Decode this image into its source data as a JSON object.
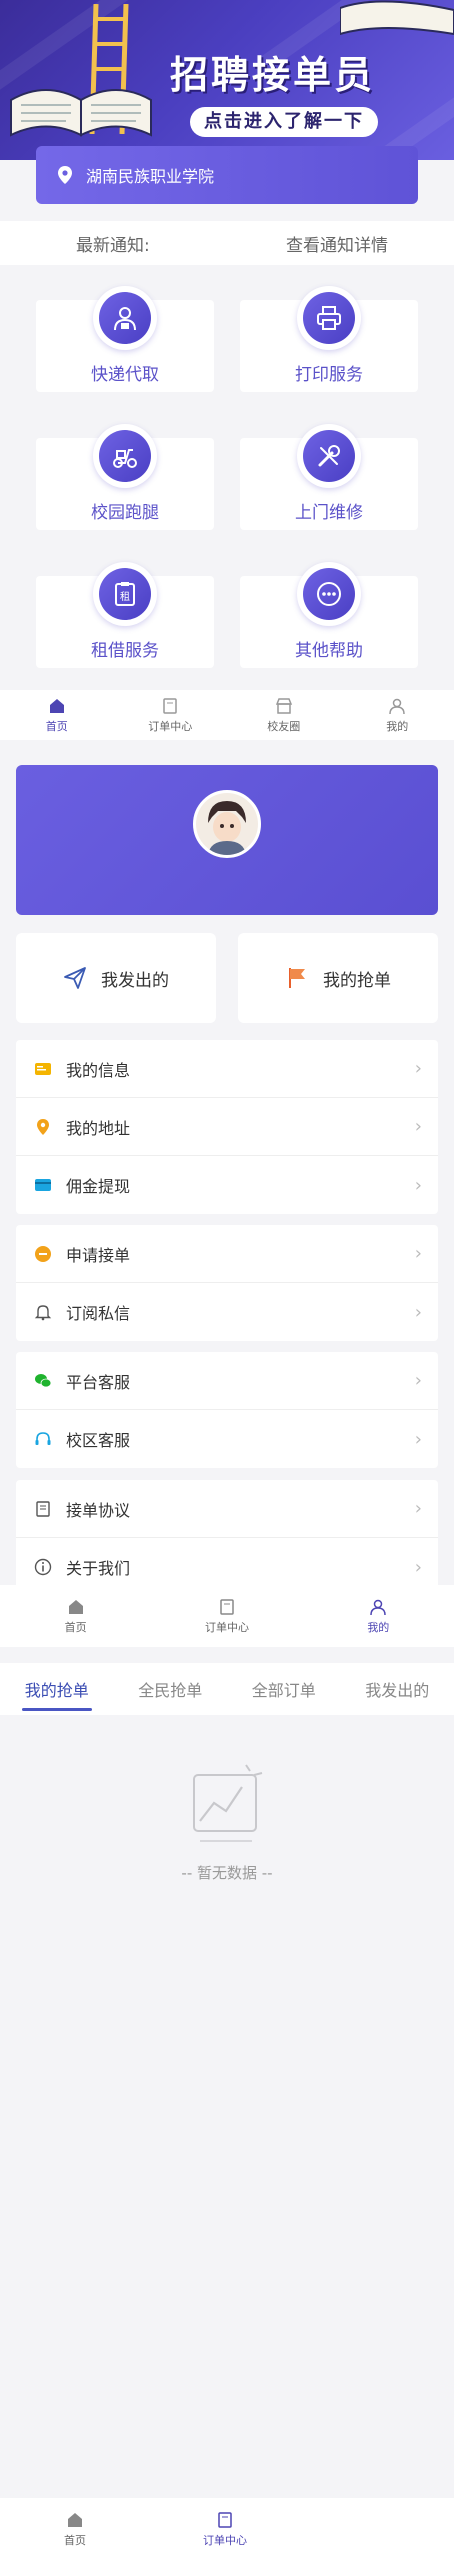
{
  "home": {
    "banner": {
      "title": "招聘接单员",
      "subtitle": "点击进入了解一下"
    },
    "school": "湖南民族职业学院",
    "notice": {
      "label": "最新通知:",
      "link": "查看通知详情"
    },
    "services": [
      {
        "label": "快递代取",
        "icon": "courier-icon"
      },
      {
        "label": "打印服务",
        "icon": "printer-icon"
      },
      {
        "label": "校园跑腿",
        "icon": "scooter-icon"
      },
      {
        "label": "上门维修",
        "icon": "wrench-icon"
      },
      {
        "label": "租借服务",
        "icon": "rent-icon"
      },
      {
        "label": "其他帮助",
        "icon": "more-icon"
      }
    ],
    "tabbar": [
      {
        "label": "首页",
        "icon": "home-icon"
      },
      {
        "label": "订单中心",
        "icon": "orders-icon"
      },
      {
        "label": "校友圈",
        "icon": "store-icon"
      },
      {
        "label": "我的",
        "icon": "user-icon"
      }
    ]
  },
  "mine": {
    "buttons": {
      "sent": "我发出的",
      "grabbed": "我的抢单"
    },
    "menu1": [
      "我的信息",
      "我的地址",
      "佣金提现"
    ],
    "menu2": [
      "申请接单",
      "订阅私信"
    ],
    "menu3": [
      "平台客服",
      "校区客服"
    ],
    "menu4": [
      "接单协议",
      "关于我们"
    ],
    "tabbar": [
      {
        "label": "首页",
        "icon": "home-icon"
      },
      {
        "label": "订单中心",
        "icon": "orders-icon"
      },
      {
        "label": "我的",
        "icon": "user-icon"
      }
    ]
  },
  "orders": {
    "tabs": [
      "我的抢单",
      "全民抢单",
      "全部订单",
      "我发出的"
    ],
    "empty": "-- 暂无数据 --",
    "tabbar": [
      {
        "label": "首页",
        "icon": "home-icon"
      },
      {
        "label": "订单中心",
        "icon": "orders-icon"
      }
    ]
  },
  "colors": {
    "accent": "#5b52c9",
    "brand_dark": "#3b2d9a",
    "tab_active": "#3b4db3"
  }
}
